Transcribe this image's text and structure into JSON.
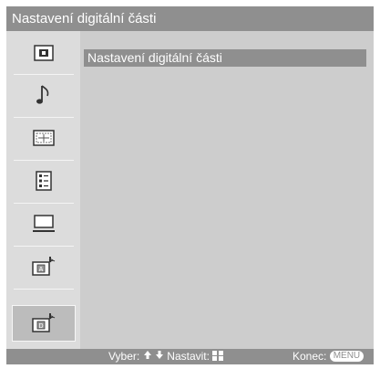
{
  "title": "Nastavení digitální části",
  "sidebar": {
    "items": [
      {
        "icon": "picture-icon"
      },
      {
        "icon": "music-note-icon"
      },
      {
        "icon": "screen-format-icon"
      },
      {
        "icon": "settings-list-icon"
      },
      {
        "icon": "pc-monitor-icon"
      },
      {
        "icon": "analog-tv-settings-icon"
      },
      {
        "icon": "digital-tv-settings-icon",
        "selected": true
      }
    ]
  },
  "menu": {
    "items": [
      {
        "label": "Nastavení digitální části",
        "selected": true
      }
    ]
  },
  "footer": {
    "select_label": "Vyber:",
    "set_label": "Nastavit:",
    "exit_label": "Konec:",
    "menu_key": "MENU"
  },
  "colors": {
    "bar": "#8f8f8f",
    "sidebar_bg": "#dcdcdc",
    "main_bg": "#cdcdcd",
    "selected_bg": "#bcbcbc"
  }
}
